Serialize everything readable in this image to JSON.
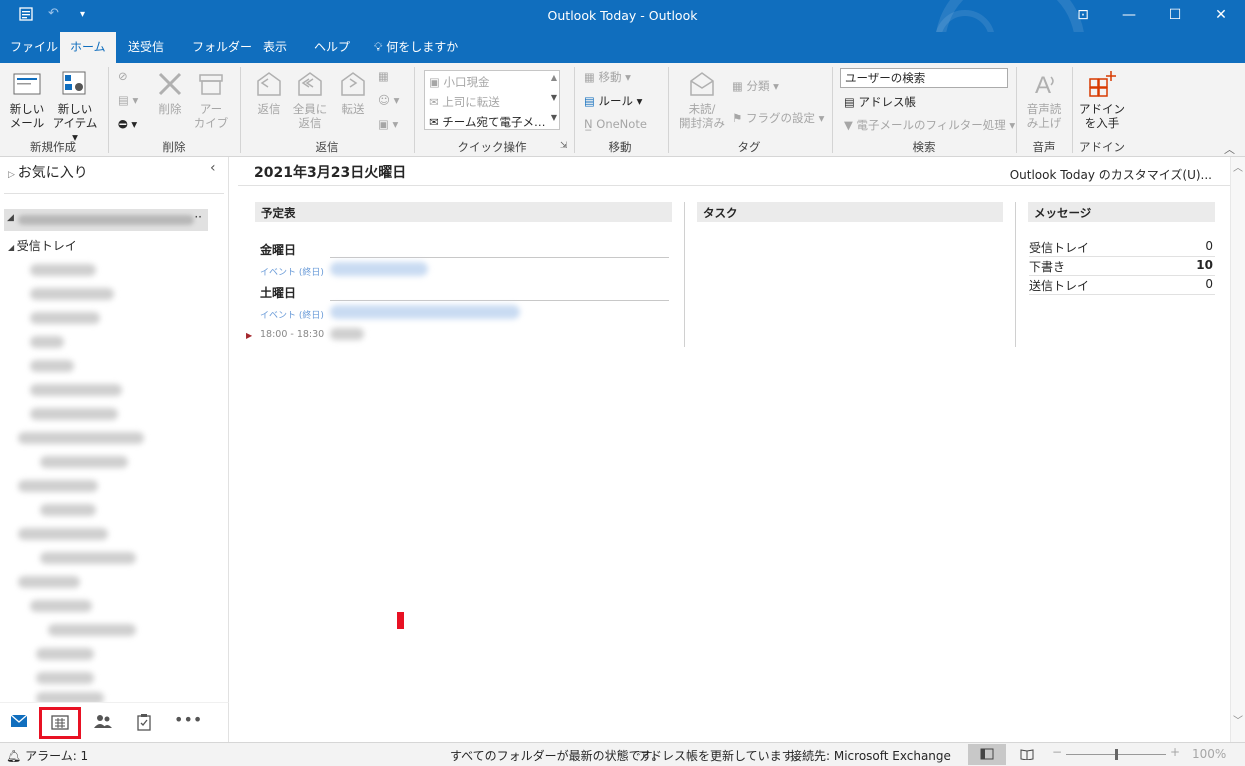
{
  "window": {
    "title": "Outlook Today  -  Outlook",
    "controls": {
      "restore_special": "⊡",
      "minimize": "—",
      "maximize": "☐",
      "close": "✕"
    }
  },
  "quick_access": {
    "undo": "↶",
    "customize": "▾"
  },
  "menu_tabs": [
    "ファイル",
    "ホーム",
    "送受信",
    "フォルダー",
    "表示",
    "ヘルプ",
    "何をしますか"
  ],
  "ribbon": {
    "new_group": {
      "new_mail": [
        "新しい",
        "メール"
      ],
      "new_item": [
        "新しい",
        "アイテム ▾"
      ],
      "label": "新規作成"
    },
    "delete_group": {
      "delete": "削除",
      "archive": [
        "アー",
        "カイブ"
      ],
      "label": "削除"
    },
    "reply_group": {
      "reply": "返信",
      "reply_all": [
        "全員に",
        "返信"
      ],
      "forward": "転送",
      "label": "返信"
    },
    "quick_steps": {
      "items": [
        "小口現金",
        "上司に転送",
        "チーム宛て電子メ…"
      ],
      "label": "クイック操作"
    },
    "move_group": {
      "move": "移動 ▾",
      "rules": "ルール ▾",
      "onenote": "OneNote",
      "label": "移動"
    },
    "tags_group": {
      "unread": [
        "未読/",
        "開封済み"
      ],
      "categorize": "分類 ▾",
      "flag": "フラグの設定 ▾",
      "label": "タグ"
    },
    "find_group": {
      "search_placeholder": "ユーザーの検索",
      "address_book": "アドレス帳",
      "filter": "電子メールのフィルター処理 ▾",
      "label": "検索"
    },
    "speech_group": {
      "read_aloud": [
        "音声読",
        "み上げ"
      ],
      "label": "音声"
    },
    "addins_group": {
      "get_addins": [
        "アドイン",
        "を入手"
      ],
      "label": "アドイン"
    }
  },
  "folder_pane": {
    "favorites": "お気に入り",
    "collapse": "‹",
    "account_dots": "··",
    "inbox": "受信トレイ"
  },
  "main": {
    "date_title": "2021年3月23日火曜日",
    "customize": "Outlook Today のカスタマイズ(U)...",
    "calendar": {
      "header": "予定表",
      "days": [
        {
          "name": "金曜日",
          "event_type": "イベント (終日)"
        },
        {
          "name": "土曜日",
          "event_type": "イベント (終日)"
        }
      ],
      "timed_event": "18:00 - 18:30"
    },
    "tasks": {
      "header": "タスク"
    },
    "messages": {
      "header": "メッセージ",
      "rows": [
        {
          "label": "受信トレイ",
          "count": "0"
        },
        {
          "label": "下書き",
          "count": "10"
        },
        {
          "label": "送信トレイ",
          "count": "0"
        }
      ]
    }
  },
  "status_bar": {
    "alarm": "アラーム: 1",
    "folders_status": "すべてのフォルダーが最新の状態です。",
    "address_book_status": "アドレス帳を更新しています。",
    "connection": "接続先: Microsoft Exchange",
    "zoom": "100%"
  }
}
